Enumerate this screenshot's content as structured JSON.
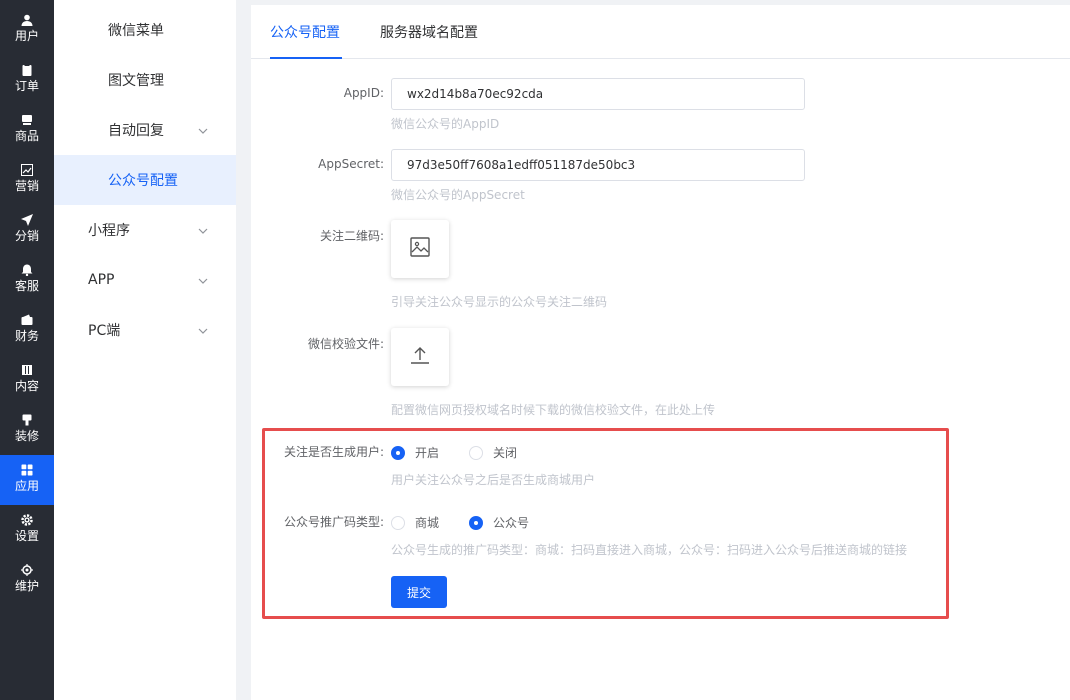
{
  "rail": [
    {
      "label": "用户",
      "icon": "user-icon"
    },
    {
      "label": "订单",
      "icon": "clipboard-icon"
    },
    {
      "label": "商品",
      "icon": "box-icon"
    },
    {
      "label": "营销",
      "icon": "chart-icon"
    },
    {
      "label": "分销",
      "icon": "send-icon"
    },
    {
      "label": "客服",
      "icon": "bell-icon"
    },
    {
      "label": "财务",
      "icon": "wallet-icon"
    },
    {
      "label": "内容",
      "icon": "book-icon"
    },
    {
      "label": "装修",
      "icon": "brush-icon"
    },
    {
      "label": "应用",
      "icon": "grid-icon",
      "active": true
    },
    {
      "label": "设置",
      "icon": "gear-icon"
    },
    {
      "label": "维护",
      "icon": "chip-icon"
    }
  ],
  "submenu": {
    "wechat_menu": "微信菜单",
    "media": "图文管理",
    "auto_reply": "自动回复",
    "oa_config": "公众号配置",
    "miniprogram": "小程序",
    "app": "APP",
    "pc": "PC端"
  },
  "tabs": {
    "oa_config": "公众号配置",
    "server_domain": "服务器域名配置"
  },
  "form": {
    "appid_label": "AppID:",
    "appid_value": "wx2d14b8a70ec92cda",
    "appid_hint": "微信公众号的AppID",
    "secret_label": "AppSecret:",
    "secret_value": "97d3e50ff7608a1edff051187de50bc3",
    "secret_hint": "微信公众号的AppSecret",
    "qrcode_label": "关注二维码:",
    "qrcode_hint": "引导关注公众号显示的公众号关注二维码",
    "verify_label": "微信校验文件:",
    "verify_hint": "配置微信网页授权域名时候下载的微信校验文件，在此处上传",
    "create_user_label": "关注是否生成用户:",
    "create_user_on": "开启",
    "create_user_off": "关闭",
    "create_user_hint": "用户关注公众号之后是否生成商城用户",
    "promo_label": "公众号推广码类型:",
    "promo_mall": "商城",
    "promo_oa": "公众号",
    "promo_hint": "公众号生成的推广码类型：商城：扫码直接进入商城，公众号：扫码进入公众号后推送商城的链接",
    "submit": "提交"
  },
  "colors": {
    "accent": "#1662f5",
    "rail_bg": "#282c34",
    "highlight": "#e64d4d"
  }
}
